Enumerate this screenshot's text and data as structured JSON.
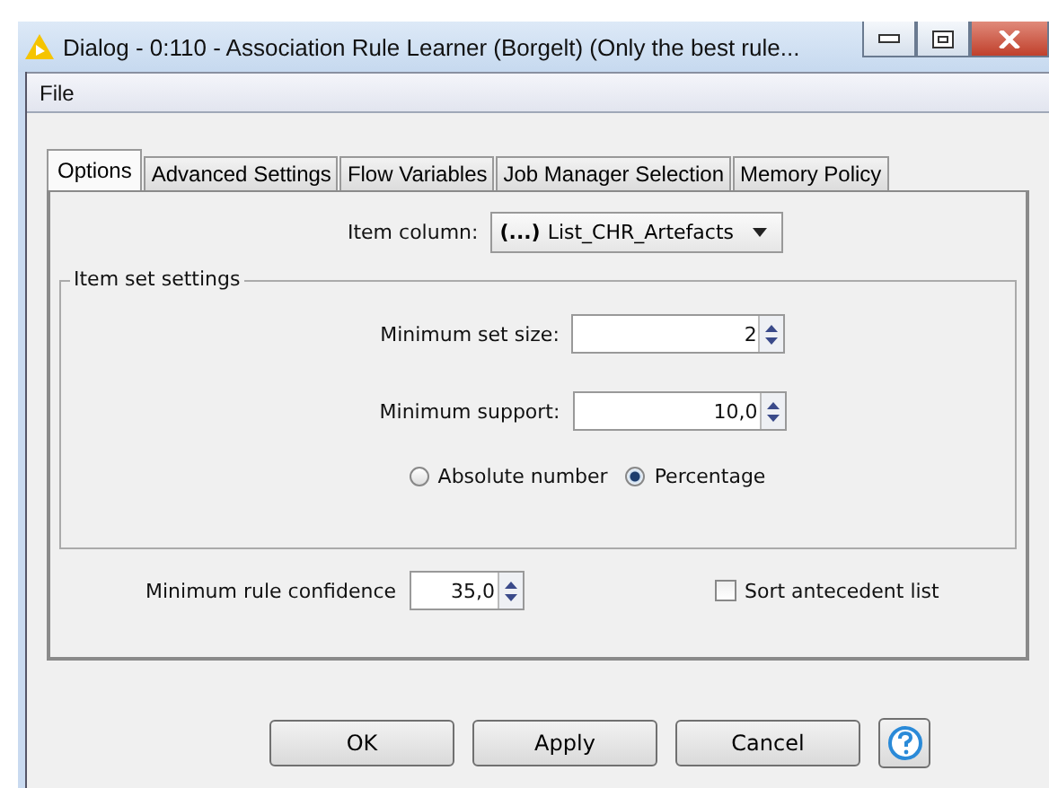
{
  "window": {
    "title": "Dialog - 0:110 - Association Rule Learner (Borgelt) (Only the best rule..."
  },
  "menu": [
    "File"
  ],
  "tabs": [
    {
      "label": "Options",
      "selected": true
    },
    {
      "label": "Advanced Settings",
      "selected": false
    },
    {
      "label": "Flow Variables",
      "selected": false
    },
    {
      "label": "Job Manager Selection",
      "selected": false
    },
    {
      "label": "Memory Policy",
      "selected": false
    }
  ],
  "item_column": {
    "label": "Item column:",
    "prefix": "(...)",
    "value": "List_CHR_Artefacts"
  },
  "item_set_settings": {
    "title": "Item set settings",
    "fields": [
      {
        "label": "Minimum set size:",
        "value": "2"
      },
      {
        "label": "Minimum support:",
        "value": "10,0"
      }
    ],
    "radios": [
      {
        "label": "Absolute number",
        "selected": false
      },
      {
        "label": "Percentage",
        "selected": true
      }
    ]
  },
  "rule_confidence": {
    "label": "Minimum rule confidence",
    "value": "35,0"
  },
  "sort_antecedent": {
    "label": "Sort antecedent list",
    "checked": false
  },
  "buttons": [
    "OK",
    "Apply",
    "Cancel"
  ]
}
